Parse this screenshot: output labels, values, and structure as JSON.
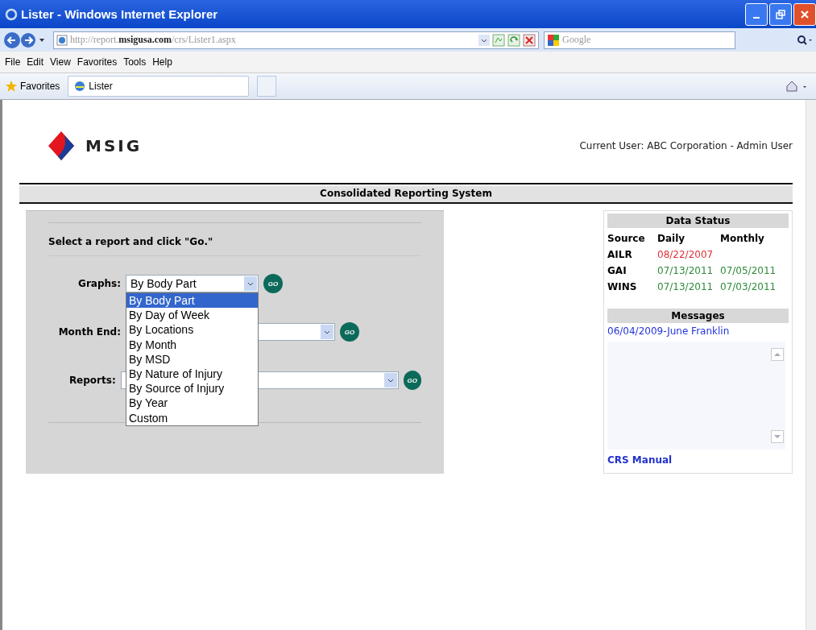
{
  "window": {
    "title": "Lister - Windows Internet Explorer"
  },
  "address_bar": {
    "url_prefix": "http://report.",
    "url_domain": "msigusa.com",
    "url_path": "/crs/Lister1.aspx",
    "search_placeholder": "Google"
  },
  "menu": [
    "File",
    "Edit",
    "View",
    "Favorites",
    "Tools",
    "Help"
  ],
  "favorites_bar": {
    "favorites_label": "Favorites",
    "tab_title": "Lister"
  },
  "page": {
    "logo_text": "MSIG",
    "current_user": "Current User: ABC Corporation - Admin User",
    "system_title": "Consolidated Reporting System",
    "form": {
      "instruction": "Select a report and click \"Go.\"",
      "fields": [
        {
          "label": "Graphs:",
          "value": "By Body Part",
          "expanded": true,
          "go": "GO"
        },
        {
          "label": "Month End:",
          "expanded": false,
          "go": "GO"
        },
        {
          "label": "Reports:",
          "expanded": false,
          "go": "GO"
        }
      ],
      "dropdown_options": [
        {
          "label": "By Body Part",
          "selected": true
        },
        {
          "label": "By Day of Week",
          "selected": false
        },
        {
          "label": "By Locations",
          "selected": false
        },
        {
          "label": "By Month",
          "selected": false
        },
        {
          "label": "By MSD",
          "selected": false
        },
        {
          "label": "By Nature of Injury",
          "selected": false
        },
        {
          "label": "By Source of Injury",
          "selected": false
        },
        {
          "label": "By Year",
          "selected": false
        },
        {
          "label": "Custom",
          "selected": false
        }
      ]
    },
    "data_status": {
      "title": "Data Status",
      "columns": [
        "Source",
        "Daily",
        "Monthly"
      ],
      "rows": [
        {
          "source": "AILR",
          "daily": {
            "text": "08/22/2007",
            "color": "#e0303a"
          }
        },
        {
          "source": "GAI",
          "daily": {
            "text": "07/13/2011",
            "color": "#2e8b3a"
          },
          "monthly": {
            "text": "07/05/2011",
            "color": "#2e8b3a"
          }
        },
        {
          "source": "WINS",
          "daily": {
            "text": "07/13/2011",
            "color": "#2e8b3a"
          },
          "monthly": {
            "text": "07/03/2011",
            "color": "#2e8b3a"
          }
        }
      ]
    },
    "messages": {
      "title": "Messages",
      "items": [
        "06/04/2009-June Franklin"
      ]
    },
    "manual_link": "CRS Manual"
  }
}
